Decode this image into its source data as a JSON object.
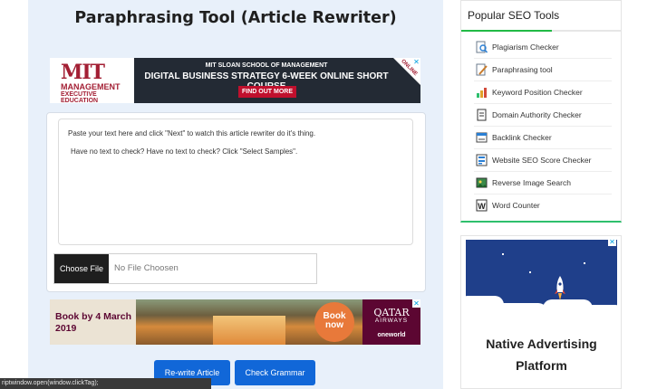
{
  "page": {
    "title": "Paraphrasing Tool (Article Rewriter)"
  },
  "ad_top": {
    "brand": "MIT",
    "brand_line1": "MANAGEMENT",
    "brand_line2": "EXECUTIVE EDUCATION",
    "school": "MIT SLOAN SCHOOL OF MANAGEMENT",
    "course": "DIGITAL BUSINESS STRATEGY 6-WEEK ONLINE SHORT COURSE",
    "cta": "FIND OUT MORE",
    "corner": "ONLINE",
    "close": "✕"
  },
  "editor": {
    "line1": "Paste your text here and click \"Next\" to watch this article rewriter do it's thing.",
    "line2": "Have no text to check? Have no text to check? Click \"Select Samples\".",
    "file_button": "Choose File",
    "file_name": "No File Choosen"
  },
  "ad_bottom": {
    "promo": "Book by 4 March 2019",
    "book_now": "Book now",
    "airline": "QATAR",
    "airways": "AIRWAYS",
    "alliance": "oneworld",
    "close": "✕"
  },
  "actions": {
    "rewrite": "Re-write Article",
    "grammar": "Check Grammar"
  },
  "status_bar": "riptwindow.open(window.clickTag);",
  "sidebar": {
    "title": "Popular SEO Tools",
    "tools": [
      {
        "label": "Plagiarism Checker",
        "icon": "magnifier-doc-icon"
      },
      {
        "label": "Paraphrasing tool",
        "icon": "pen-doc-icon"
      },
      {
        "label": "Keyword Position Checker",
        "icon": "chart-icon"
      },
      {
        "label": "Domain Authority Checker",
        "icon": "document-icon"
      },
      {
        "label": "Backlink Checker",
        "icon": "link-icon"
      },
      {
        "label": "Website SEO Score Checker",
        "icon": "score-icon"
      },
      {
        "label": "Reverse Image Search",
        "icon": "image-icon"
      },
      {
        "label": "Word Counter",
        "icon": "word-icon"
      }
    ]
  },
  "ad_right": {
    "headline": "Native Advertising Platform",
    "close": "✕"
  },
  "colors": {
    "accent": "#1167d8",
    "green": "#21ba45",
    "panel": "#e8f0fa"
  }
}
